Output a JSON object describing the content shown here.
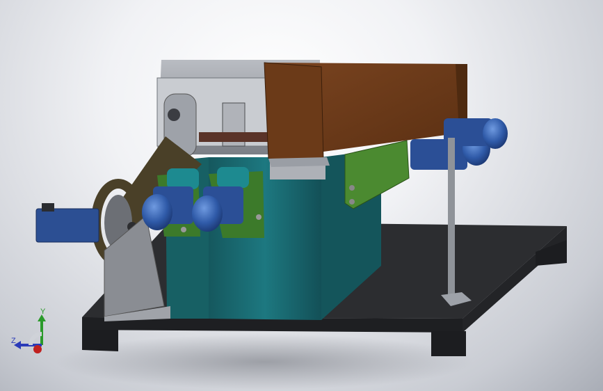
{
  "triad": {
    "y_label": "Y",
    "z_label": "Z"
  },
  "colors": {
    "background_center": "#ffffff",
    "background_edge": "#a9adb6",
    "base_plate": "#2b2c2f",
    "frame_teal": "#1b6e74",
    "hopper_brown": "#6a3a1a",
    "motor_blue": "#2f5aa8",
    "mount_green": "#3d7d2a",
    "belt": "#4a4028",
    "steel_gray": "#8f9399"
  },
  "icons": [
    "coordinate-triad-icon"
  ]
}
